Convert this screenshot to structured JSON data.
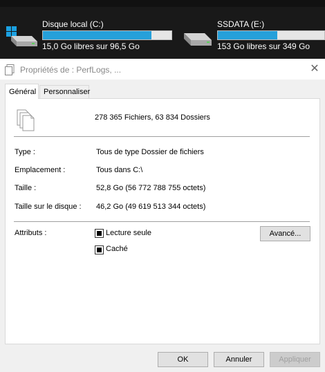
{
  "drives": [
    {
      "name": "Disque local (C:)",
      "free_text": "15,0 Go libres sur 96,5 Go",
      "used_fraction": 0.845,
      "icon": "windows-drive-icon"
    },
    {
      "name": "SSDATA (E:)",
      "free_text": "153 Go libres sur 349 Go",
      "used_fraction": 0.56,
      "icon": "hard-drive-icon"
    }
  ],
  "dialog": {
    "title": "Propriétés de : PerfLogs, ...",
    "close_glyph": "✕",
    "tabs": [
      {
        "label": "Général",
        "active": true
      },
      {
        "label": "Personnaliser",
        "active": false
      }
    ],
    "summary": "278 365 Fichiers, 63 834 Dossiers",
    "properties": [
      {
        "label": "Type :",
        "value": "Tous de type Dossier de fichiers"
      },
      {
        "label": "Emplacement :",
        "value": "Tous dans C:\\"
      },
      {
        "label": "Taille :",
        "value": "52,8 Go (56 772 788 755 octets)"
      },
      {
        "label": "Taille sur le disque :",
        "value": "46,2 Go (49 619 513 344 octets)"
      }
    ],
    "attributes": {
      "label": "Attributs :",
      "read_only": {
        "label": "Lecture seule",
        "state": "indeterminate"
      },
      "hidden": {
        "label": "Caché",
        "state": "indeterminate"
      },
      "advanced_button": "Avancé..."
    },
    "buttons": {
      "ok": "OK",
      "cancel": "Annuler",
      "apply": "Appliquer"
    }
  },
  "colors": {
    "bar_fill": "#26a0da",
    "background_dark": "#191919",
    "dialog_bg": "#f0f0f0"
  }
}
